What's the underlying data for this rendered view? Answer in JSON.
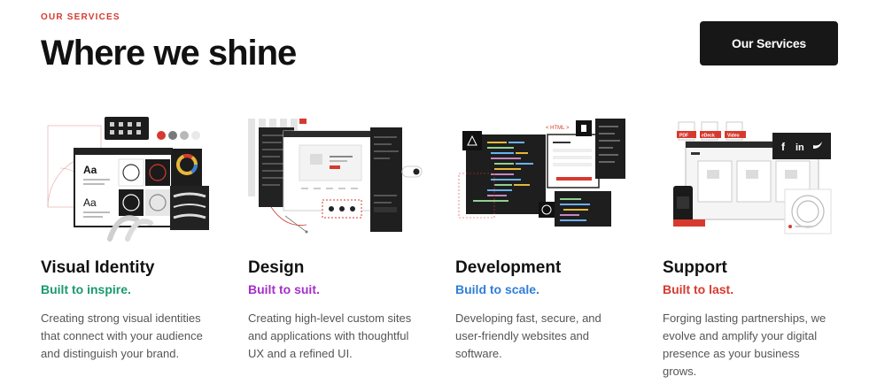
{
  "header": {
    "eyebrow": "OUR SERVICES",
    "title": "Where we shine",
    "cta_label": "Our Services"
  },
  "services": [
    {
      "title": "Visual Identity",
      "tagline": "Built to inspire.",
      "tagline_color": "#1a9a6c",
      "description": "Creating strong visual identities that connect with your audience and distinguish your brand.",
      "art_text": {
        "typeA": "Aa",
        "typeB": "Aa"
      }
    },
    {
      "title": "Design",
      "tagline": "Built to suit.",
      "tagline_color": "#a52fc8",
      "description": "Creating high-level custom sites and applications with thoughtful UX and a refined UI."
    },
    {
      "title": "Development",
      "tagline": "Build to scale.",
      "tagline_color": "#2f7ed8",
      "description": "Developing fast, secure, and user-friendly websites and software.",
      "art_text": {
        "html_tag": "< HTML >"
      }
    },
    {
      "title": "Support",
      "tagline": "Built to last.",
      "tagline_color": "#d63a2f",
      "description": "Forging lasting partnerships, we evolve and amplify your digital presence as your business grows.",
      "art_text": {
        "badges": [
          "PDF",
          "eDeck",
          "Video"
        ],
        "social": [
          "f",
          "in"
        ]
      }
    }
  ],
  "colors": {
    "accent_red": "#d63a2f",
    "dark": "#171717"
  }
}
